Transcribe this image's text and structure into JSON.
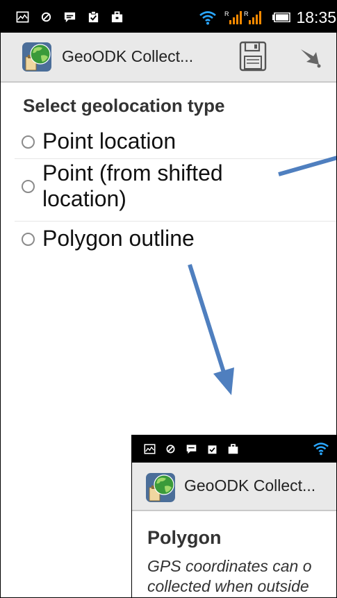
{
  "status_bar": {
    "time": "18:35",
    "left_icons": [
      "gallery-icon",
      "sync-icon",
      "message-icon",
      "clipboard-check-icon",
      "briefcase-icon"
    ],
    "right_icons": [
      "wifi-icon",
      "signal-icon",
      "battery-icon"
    ]
  },
  "action_bar": {
    "app_icon": "geoodk-globe-icon",
    "title": "GeoODK Collect...",
    "actions": [
      "save-icon",
      "forward-icon"
    ]
  },
  "form": {
    "question": "Select geolocation type",
    "options": [
      {
        "label": "Point location",
        "selected": false
      },
      {
        "label": "Point (from shifted location)",
        "label_line1": "Point (from shifted",
        "label_line2": "location)",
        "selected": false
      },
      {
        "label": "Polygon outline",
        "selected": false
      }
    ]
  },
  "inset": {
    "title": "GeoODK Collect...",
    "heading": "Polygon",
    "hint_line1": "GPS coordinates can o",
    "hint_line2": "collected when outside"
  },
  "colors": {
    "status_bar_bg": "#000000",
    "action_bar_bg": "#e9e9e9",
    "arrow": "#4f7fbf",
    "wifi": "#2aa7ff",
    "signal": "#ff8a00"
  }
}
